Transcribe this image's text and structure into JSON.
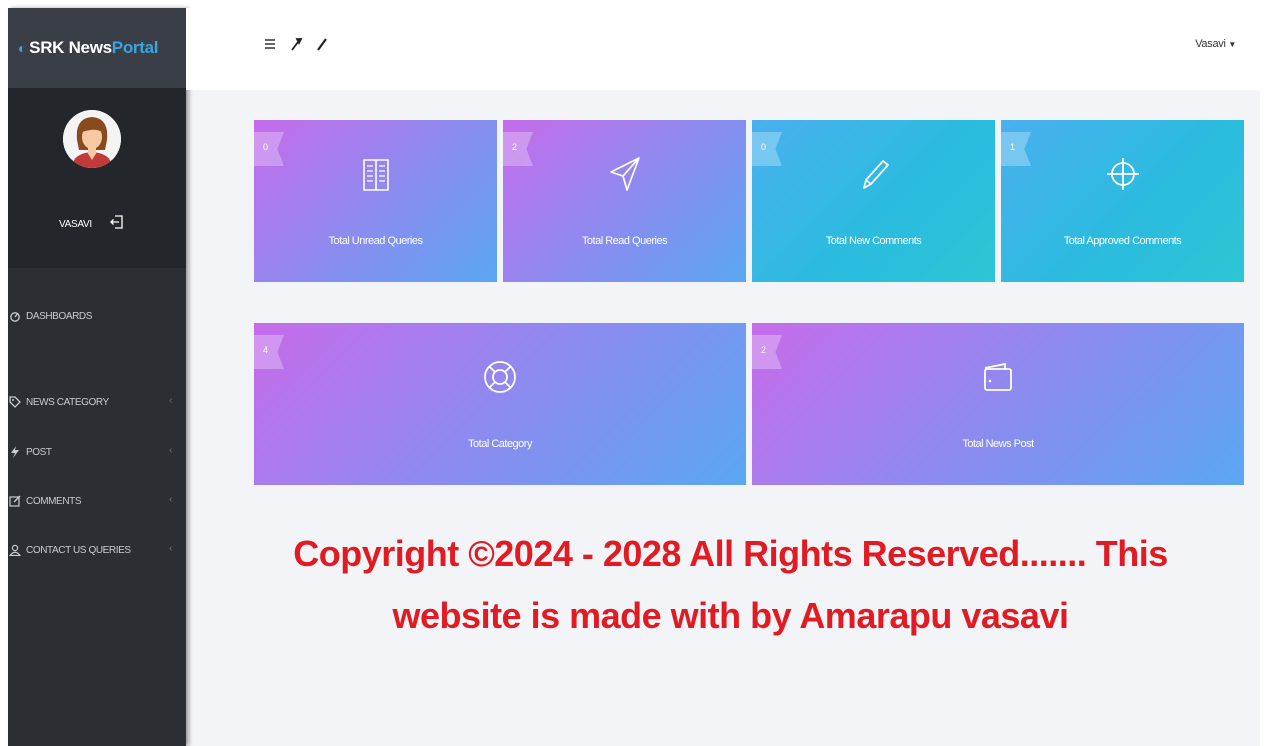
{
  "brand": {
    "part1": "SRK News",
    "part2": "Portal"
  },
  "profile": {
    "username": "VASAVI"
  },
  "nav": [
    {
      "label": "DASHBOARDS",
      "icon": "dashboard-icon"
    },
    {
      "label": "NEWS CATEGORY",
      "icon": "tag-icon"
    },
    {
      "label": "POST",
      "icon": "flash-icon"
    },
    {
      "label": "COMMENTS",
      "icon": "edit-icon"
    },
    {
      "label": "CONTACT US QUERIES",
      "icon": "user-icon"
    }
  ],
  "topbar": {
    "user": "Vasavi"
  },
  "cards": [
    {
      "count": "0",
      "label": "Total Unread Queries",
      "icon": "book-icon"
    },
    {
      "count": "2",
      "label": "Total Read Queries",
      "icon": "paper-plane-icon"
    },
    {
      "count": "0",
      "label": "Total New Comments",
      "icon": "pencil-icon"
    },
    {
      "count": "1",
      "label": "Total Approved Comments",
      "icon": "crosshair-icon"
    },
    {
      "count": "4",
      "label": "Total Category",
      "icon": "life-ring-icon"
    },
    {
      "count": "2",
      "label": "Total News Post",
      "icon": "wallet-icon"
    }
  ],
  "footer": {
    "line1": "Copyright ©2024 - 2028 All Rights Reserved....... This",
    "line2": "website is made with by Amarapu vasavi"
  },
  "colors": {
    "accent": "#3ba3e0",
    "sidebar": "#2b2e33",
    "copyright": "#e01b23",
    "gradient_purple_start": "#c76bea",
    "gradient_cyan": "#2bbbdf"
  }
}
